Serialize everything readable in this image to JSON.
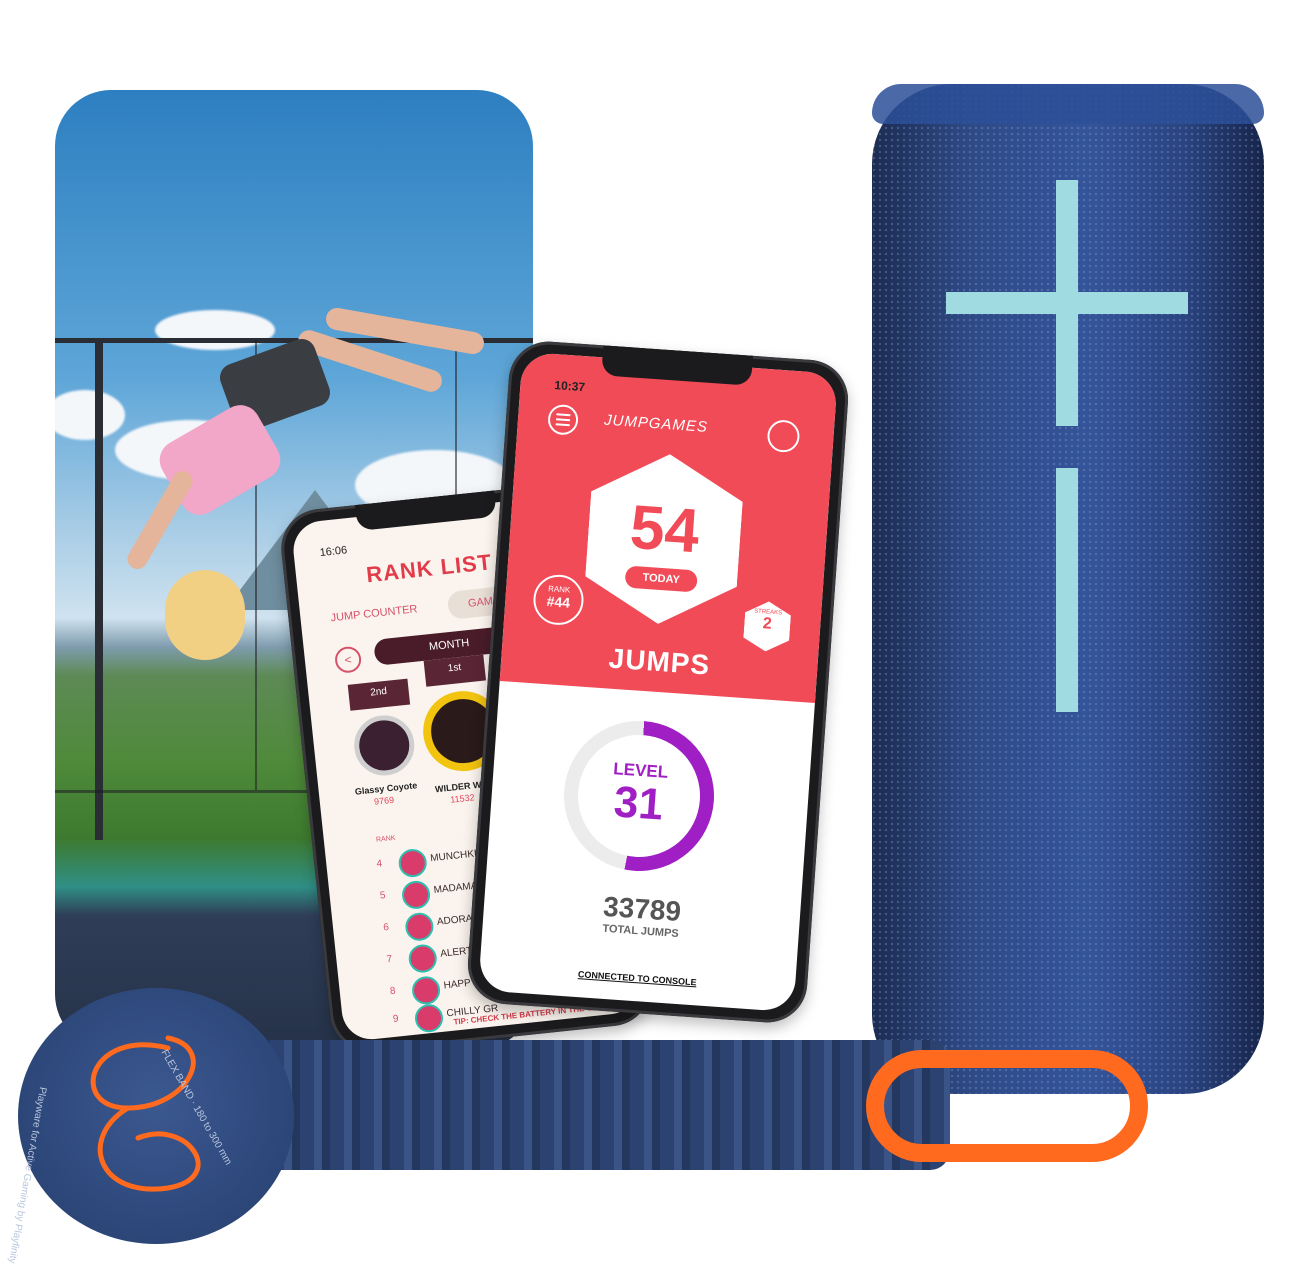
{
  "photo": {
    "scene": ""
  },
  "phone_rank": {
    "time": "16:06",
    "title": "RANK LIST",
    "tabs": [
      "JUMP COUNTER",
      "GAMES"
    ],
    "period": "MONTH",
    "podium": [
      {
        "place": "2nd",
        "name": "Glassy Coyote",
        "score": "9769"
      },
      {
        "place": "1st",
        "name": "WILDER WATZ",
        "score": "11532"
      }
    ],
    "rank_header": "RANK",
    "rows": [
      {
        "rank": "4",
        "name": "MUNCHKIN"
      },
      {
        "rank": "5",
        "name": "MADAMAZIN"
      },
      {
        "rank": "6",
        "name": "ADORABLE F"
      },
      {
        "rank": "7",
        "name": "ALERT ALL"
      },
      {
        "rank": "8",
        "name": "HAPPY"
      },
      {
        "rank": "9",
        "name": "CHILLY GR"
      }
    ],
    "tip": "TIP: CHECK THE BATTERY IN THE CO"
  },
  "phone_jump": {
    "time": "10:37",
    "brand": "JUMPGAMES",
    "jumps_today": "54",
    "today_label": "TODAY",
    "rank_label": "RANK",
    "rank_value": "#44",
    "streaks_label": "STREAKS",
    "streaks_value": "2",
    "jumps_label": "JUMPS",
    "level_label": "LEVEL",
    "level_value": "31",
    "level_progress": 0.52,
    "total_jumps": "33789",
    "total_label": "TOTAL JUMPS",
    "status": "CONNECTED TO CONSOLE"
  },
  "band": {
    "label_top": "FLEX BAND · 180 to 300 mm",
    "label_side": "Playware for Active Gaming by Playfinity"
  },
  "colors": {
    "app_red": "#f04b56",
    "level_purple": "#a01fc4",
    "speaker_blue": "#2e4a86",
    "speaker_accent": "#9fdbe0",
    "band_orange": "#ff6a1f"
  }
}
